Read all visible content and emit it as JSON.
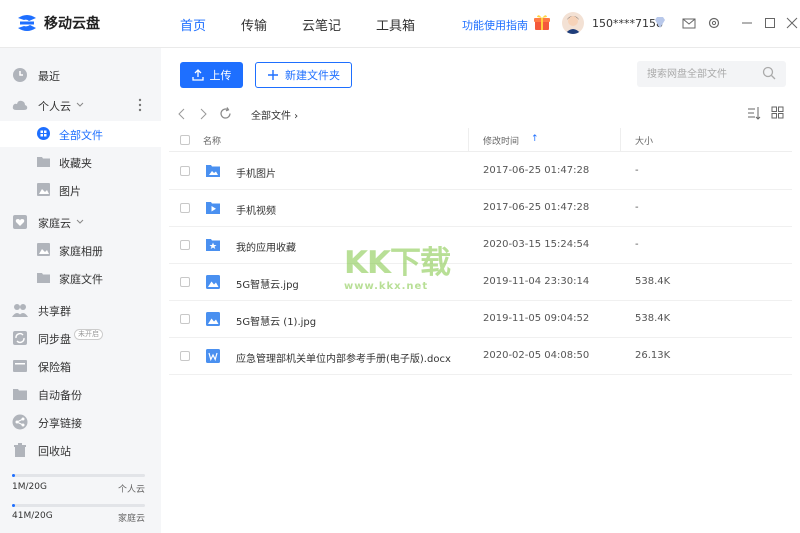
{
  "app": {
    "title": "移动云盘",
    "colors": {
      "accent": "#1e6fff",
      "sidebar_bg": "#f5f6f8",
      "watermark": "#7ec440"
    }
  },
  "nav": {
    "items": [
      {
        "label": "首页",
        "active": true
      },
      {
        "label": "传输",
        "active": false
      },
      {
        "label": "云笔记",
        "active": false
      },
      {
        "label": "工具箱",
        "active": false
      }
    ]
  },
  "header": {
    "guide_link": "功能使用指南",
    "phone": "150****7158",
    "icons": [
      "gift-icon",
      "avatar",
      "vip-diamond-icon",
      "mail-icon",
      "settings-gear-icon",
      "minimize-icon",
      "maximize-icon",
      "close-icon"
    ]
  },
  "sidebar": {
    "recent": "最近",
    "personal_cloud": "个人云",
    "all_files": "全部文件",
    "favorites": "收藏夹",
    "pictures": "图片",
    "family_cloud": "家庭云",
    "family_album": "家庭相册",
    "family_files": "家庭文件",
    "share_group": "共享群",
    "sync_disk": "同步盘",
    "sync_badge": "未开启",
    "safe_box": "保险箱",
    "auto_backup": "自动备份",
    "share_link": "分享链接",
    "recycle_bin": "回收站",
    "storage": [
      {
        "used": "1M/20G",
        "label": "个人云",
        "fraction": 0.01
      },
      {
        "used": "41M/20G",
        "label": "家庭云",
        "fraction": 0.02
      }
    ]
  },
  "toolbar": {
    "upload_label": "上传",
    "new_folder_label": "新建文件夹",
    "search_placeholder": "搜索网盘全部文件"
  },
  "breadcrumb": {
    "current": "全部文件 ›"
  },
  "table": {
    "headers": {
      "name": "名称",
      "modified": "修改时间",
      "size": "大小"
    },
    "sort_indicator": "↑",
    "rows": [
      {
        "name": "手机图片",
        "modified": "2017-06-25 01:47:28",
        "size": "-",
        "icon": "folder-image-icon"
      },
      {
        "name": "手机视频",
        "modified": "2017-06-25 01:47:28",
        "size": "-",
        "icon": "folder-video-icon"
      },
      {
        "name": "我的应用收藏",
        "modified": "2020-03-15 15:24:54",
        "size": "-",
        "icon": "folder-star-icon"
      },
      {
        "name": "5G智慧云.jpg",
        "modified": "2019-11-04 23:30:14",
        "size": "538.4K",
        "icon": "image-file-icon"
      },
      {
        "name": "5G智慧云 (1).jpg",
        "modified": "2019-11-05 09:04:52",
        "size": "538.4K",
        "icon": "image-file-icon"
      },
      {
        "name": "应急管理部机关单位内部参考手册(电子版).docx",
        "modified": "2020-02-05 04:08:50",
        "size": "26.13K",
        "icon": "word-file-icon"
      }
    ]
  },
  "watermark": {
    "big": "KK下载",
    "small": "www.kkx.net"
  }
}
